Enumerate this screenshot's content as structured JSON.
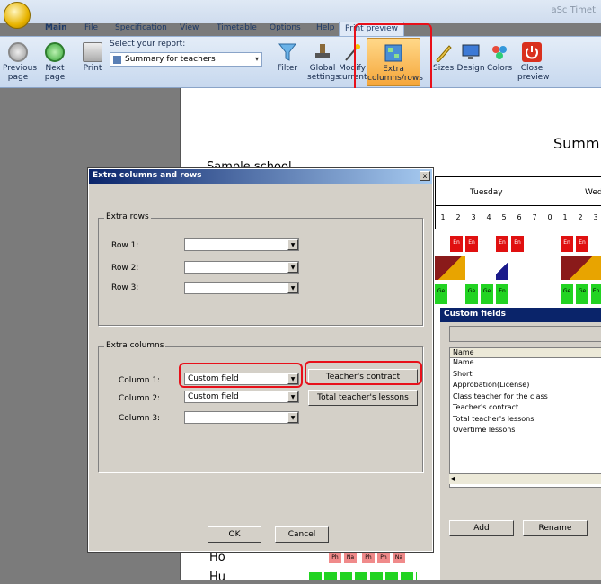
{
  "app": {
    "title": "aSc Timet"
  },
  "tabs": [
    "Main",
    "File",
    "Specification",
    "View",
    "Timetable",
    "Options",
    "Help",
    "Print preview"
  ],
  "ribbon": {
    "previous": "Previous page",
    "next": "Next page",
    "print": "Print",
    "report_label": "Select your report:",
    "report_value": "Summary for teachers",
    "filter": "Filter",
    "global": "Global settings",
    "modify": "Modify current",
    "extra": "Extra columns/rows",
    "sizes": "Sizes",
    "design": "Design",
    "colors": "Colors",
    "close": "Close preview"
  },
  "document": {
    "title": "Summ",
    "school": "Sample school",
    "days": [
      "Tuesday",
      "Wed"
    ],
    "tue_periods": [
      "1",
      "2",
      "3",
      "4",
      "5",
      "6",
      "7"
    ],
    "wed_periods": [
      "0",
      "1",
      "2",
      "3"
    ],
    "row_ho": "Ho",
    "row_hu": "Hu",
    "cells": [
      "En",
      "En",
      "En",
      "En",
      "En",
      "En",
      "Ge",
      "Ge",
      "Ge",
      "En",
      "Ge",
      "Ge",
      "En",
      "Ph",
      "Na",
      "Ph",
      "Ph",
      "Na"
    ]
  },
  "dialog": {
    "title": "Extra columns and rows",
    "close": "x",
    "extra_rows": "Extra rows",
    "row1": "Row 1:",
    "row2": "Row 2:",
    "row3": "Row 3:",
    "extra_columns": "Extra columns",
    "col1": "Column 1:",
    "col2": "Column 2:",
    "col3": "Column 3:",
    "col1_value": "Custom field",
    "col2_value": "Custom field",
    "col1_btn": "Teacher's contract",
    "col2_btn": "Total teacher's lessons",
    "ok": "OK",
    "cancel": "Cancel"
  },
  "custom_fields": {
    "title": "Custom fields",
    "header": "Name",
    "items": [
      "Name",
      "Short",
      "Approbation(License)",
      "Class teacher for the class",
      "Teacher's contract",
      "Total teacher's lessons",
      "Overtime lessons"
    ],
    "add": "Add",
    "rename": "Rename"
  }
}
